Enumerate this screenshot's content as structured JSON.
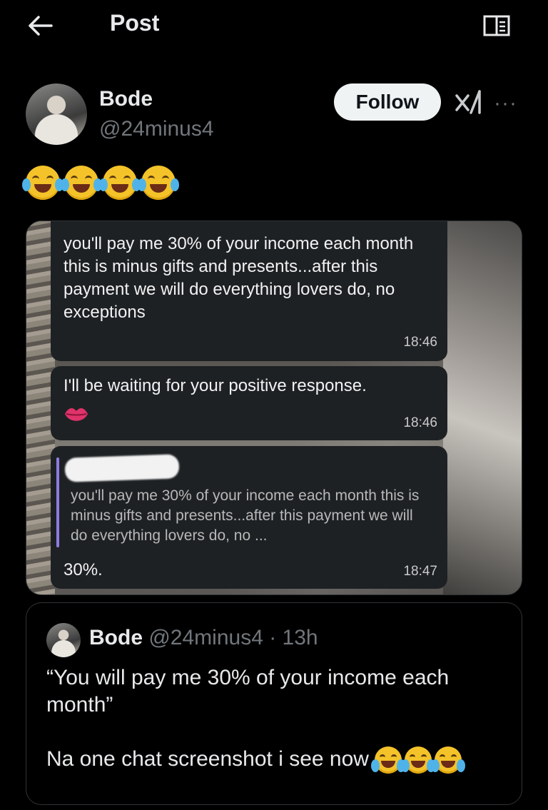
{
  "header": {
    "title": "Post"
  },
  "post": {
    "author_name": "Bode",
    "author_handle": "@24minus4",
    "follow_label": "Follow",
    "more_label": "···",
    "text_emojis": [
      "face-with-tears-of-joy-icon",
      "face-with-tears-of-joy-icon",
      "face-with-tears-of-joy-icon",
      "face-with-tears-of-joy-icon"
    ]
  },
  "media": {
    "bubble1": {
      "text": "you'll pay me 30% of your income each month this is minus gifts and presents...after this payment we will do everything lovers do, no exceptions",
      "time": "18:46"
    },
    "bubble2": {
      "text": "I'll be waiting for your positive response.",
      "time": "18:46"
    },
    "bubble3": {
      "quoted": "you'll pay me 30% of your income each month this is minus gifts and presents...after this payment we will do everything lovers do, no ...",
      "reply": "30%.",
      "time": "18:47"
    }
  },
  "quote": {
    "name": "Bode",
    "handle_time": "@24minus4 · 13h",
    "body": "“You will pay me 30% of your income each month”\n\nNa one chat screenshot i see now "
  }
}
